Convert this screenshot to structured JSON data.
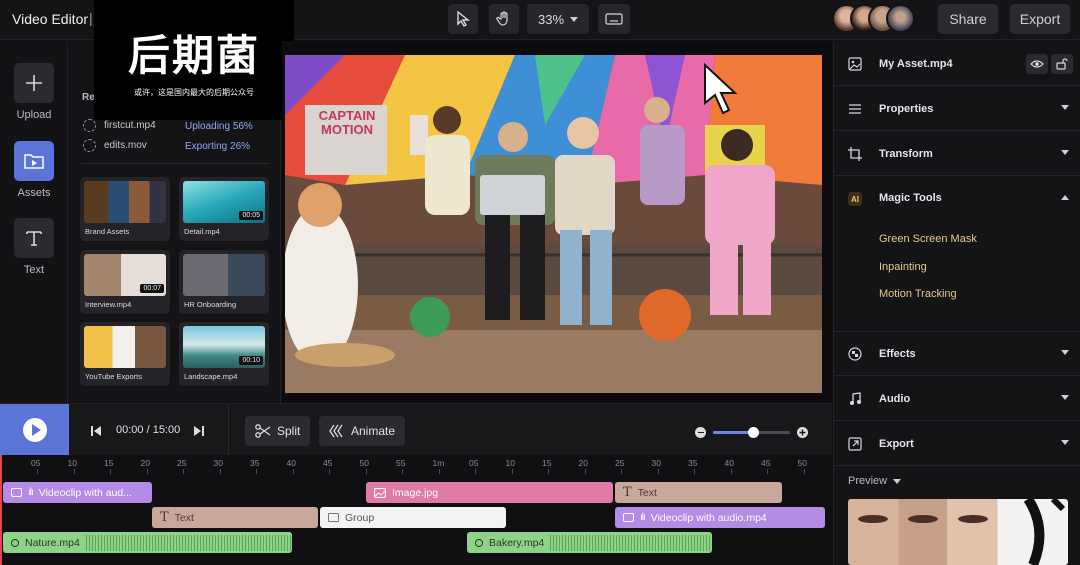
{
  "app": {
    "title": "Video Editor",
    "separator": "|"
  },
  "watermark": {
    "brand": "后期菌",
    "tagline": "或许，这是国内最大的后期公众号"
  },
  "toolbar": {
    "zoom": "33%",
    "share_label": "Share",
    "export_label": "Export"
  },
  "rail": [
    {
      "label": "Upload",
      "icon": "plus-icon"
    },
    {
      "label": "Assets",
      "icon": "folder-play-icon",
      "active": true
    },
    {
      "label": "Text",
      "icon": "text-t-icon"
    }
  ],
  "assets_panel": {
    "section_title": "Re",
    "uploads": [
      {
        "name": "firstcut.mp4",
        "status": "Uploading 56%"
      },
      {
        "name": "edits.mov",
        "status": "Exporting 26%"
      }
    ],
    "tiles": [
      {
        "label": "Brand Assets",
        "duration": ""
      },
      {
        "label": "Detail.mp4",
        "duration": "00:05"
      },
      {
        "label": "Interview.mp4",
        "duration": "00:07"
      },
      {
        "label": "HR Onboarding",
        "duration": ""
      },
      {
        "label": "YouTube Exports",
        "duration": ""
      },
      {
        "label": "Landscape.mp4",
        "duration": "00:10"
      }
    ]
  },
  "preview": {
    "sign_text": "CAPTAIN MOTION"
  },
  "properties_panel": {
    "asset_name": "My Asset.mp4",
    "sections": {
      "properties": "Properties",
      "transform": "Transform",
      "magic_tools": "Magic Tools",
      "effects": "Effects",
      "audio": "Audio",
      "export": "Export"
    },
    "magic_items": [
      "Green Screen Mask",
      "Inpainting",
      "Motion Tracking"
    ],
    "preview_label": "Preview",
    "ai_badge": "AI"
  },
  "playbar": {
    "time": "00:00 / 15:00",
    "split_label": "Split",
    "animate_label": "Animate",
    "zoom_level": 0.52
  },
  "timeline": {
    "ticks": [
      "05",
      "10",
      "15",
      "20",
      "25",
      "30",
      "35",
      "40",
      "45",
      "50",
      "55",
      "1m",
      "05",
      "10",
      "15",
      "20",
      "25",
      "30",
      "35",
      "40",
      "45",
      "50"
    ],
    "clips": [
      {
        "label": "Videoclip with aud...",
        "kind": "video"
      },
      {
        "label": "Image.jpg",
        "kind": "image"
      },
      {
        "label": "Text",
        "kind": "text"
      },
      {
        "label": "Text",
        "kind": "text"
      },
      {
        "label": "Group",
        "kind": "group"
      },
      {
        "label": "Videoclip with audio.mp4",
        "kind": "video"
      },
      {
        "label": "Nature.mp4",
        "kind": "audio"
      },
      {
        "label": "Bakery.mp4",
        "kind": "audio"
      }
    ]
  },
  "colors": {
    "accent": "#5a74d8",
    "magic": "#e3c98f",
    "video_clip": "#b58be8",
    "image_clip": "#e07aa6",
    "text_clip": "#c9a89b",
    "audio_clip": "#8fd38a"
  }
}
